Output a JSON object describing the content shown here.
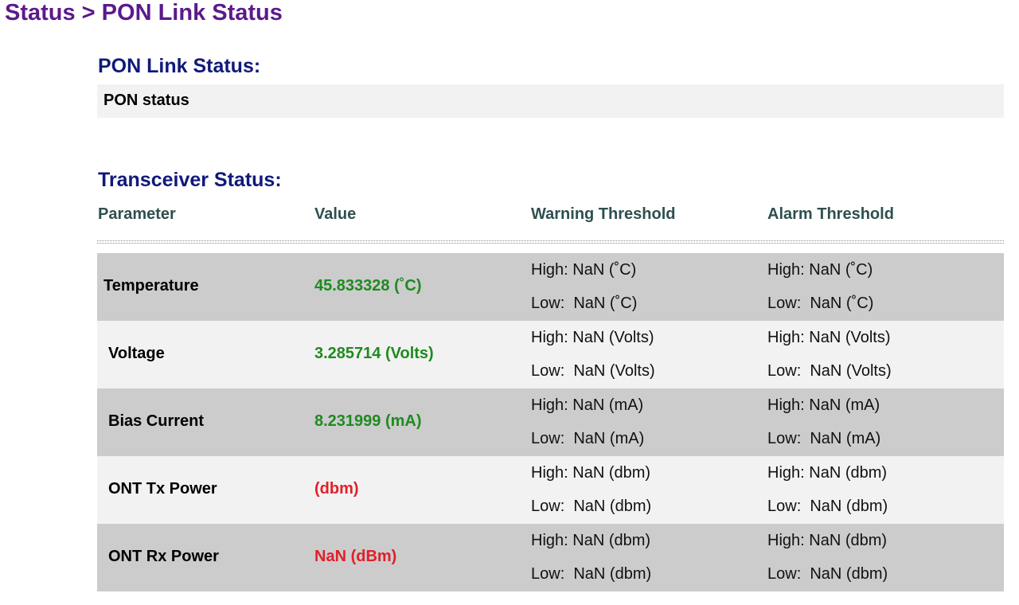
{
  "breadcrumb": "Status > PON Link Status",
  "pon": {
    "title": "PON Link Status:",
    "row_label": "PON status"
  },
  "transceiver": {
    "title": "Transceiver Status:",
    "headers": [
      "Parameter",
      "Value",
      "Warning Threshold",
      "Alarm Threshold"
    ],
    "rows": [
      {
        "parameter": "Temperature",
        "value": "45.833328 (˚C)",
        "value_status": "ok",
        "warn_high": "High: NaN (˚C)",
        "warn_low": "Low:  NaN (˚C)",
        "alarm_high": "High: NaN (˚C)",
        "alarm_low": "Low:  NaN (˚C)"
      },
      {
        "parameter": "Voltage",
        "value": "3.285714 (Volts)",
        "value_status": "ok",
        "warn_high": "High: NaN (Volts)",
        "warn_low": "Low:  NaN (Volts)",
        "alarm_high": "High: NaN (Volts)",
        "alarm_low": "Low:  NaN (Volts)"
      },
      {
        "parameter": "Bias Current",
        "value": "8.231999 (mA)",
        "value_status": "ok",
        "warn_high": "High: NaN (mA)",
        "warn_low": "Low:  NaN (mA)",
        "alarm_high": "High: NaN (mA)",
        "alarm_low": "Low:  NaN (mA)"
      },
      {
        "parameter": "ONT Tx Power",
        "value": "(dbm)",
        "value_status": "bad",
        "warn_high": "High: NaN (dbm)",
        "warn_low": "Low:  NaN (dbm)",
        "alarm_high": "High: NaN (dbm)",
        "alarm_low": "Low:  NaN (dbm)"
      },
      {
        "parameter": "ONT Rx Power",
        "value": "NaN (dBm)",
        "value_status": "bad",
        "warn_high": "High: NaN (dbm)",
        "warn_low": "Low:  NaN (dbm)",
        "alarm_high": "High: NaN (dbm)",
        "alarm_low": "Low:  NaN (dbm)"
      }
    ]
  },
  "colors": {
    "breadcrumb": "#5b1a8b",
    "section_title": "#10197a",
    "value_ok": "#1f8a1f",
    "value_bad": "#e0202a"
  }
}
